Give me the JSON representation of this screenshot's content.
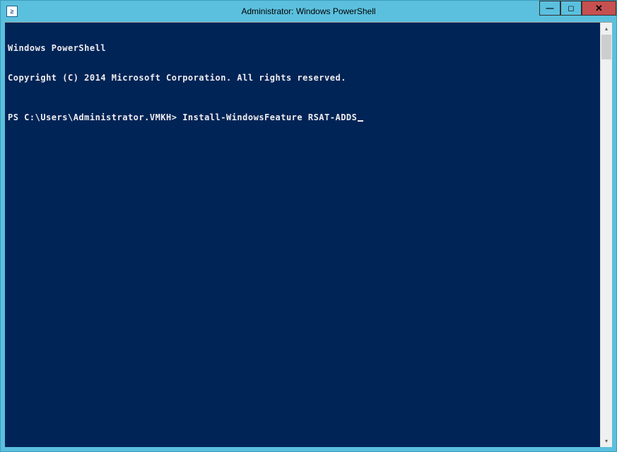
{
  "window": {
    "title": "Administrator: Windows PowerShell",
    "icon_glyph": "≥"
  },
  "controls": {
    "minimize": "—",
    "maximize": "◻",
    "close": "✕"
  },
  "console": {
    "header_line1": "Windows PowerShell",
    "header_line2": "Copyright (C) 2014 Microsoft Corporation. All rights reserved.",
    "prompt": "PS C:\\Users\\Administrator.VMKH> ",
    "command": "Install-WindowsFeature RSAT-ADDS"
  },
  "scrollbar": {
    "up": "▴",
    "down": "▾"
  }
}
